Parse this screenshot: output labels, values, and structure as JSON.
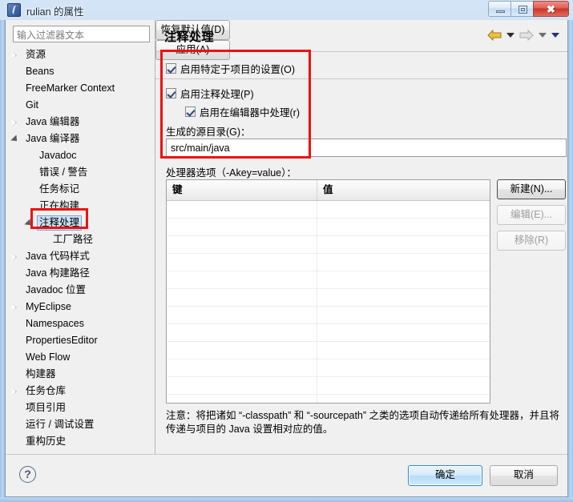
{
  "window": {
    "title": "rulian 的属性",
    "icon": "eclipse-icon",
    "buttons": {
      "minimize": "minimize-icon",
      "maximize": "maximize-icon",
      "close": "✖"
    }
  },
  "sidebar": {
    "filter": {
      "placeholder": "输入过滤器文本",
      "value": ""
    },
    "items": [
      {
        "label": "资源",
        "indent": 0,
        "state": "collapsed"
      },
      {
        "label": "Beans",
        "indent": 0,
        "state": "leaf"
      },
      {
        "label": "FreeMarker Context",
        "indent": 0,
        "state": "leaf"
      },
      {
        "label": "Git",
        "indent": 0,
        "state": "leaf"
      },
      {
        "label": "Java 编辑器",
        "indent": 0,
        "state": "collapsed"
      },
      {
        "label": "Java 编译器",
        "indent": 0,
        "state": "expanded"
      },
      {
        "label": "Javadoc",
        "indent": 1,
        "state": "leaf"
      },
      {
        "label": "错误 / 警告",
        "indent": 1,
        "state": "leaf"
      },
      {
        "label": "任务标记",
        "indent": 1,
        "state": "leaf"
      },
      {
        "label": "正在构建",
        "indent": 1,
        "state": "leaf"
      },
      {
        "label": "注释处理",
        "indent": 1,
        "state": "expanded",
        "selected": true
      },
      {
        "label": "工厂路径",
        "indent": 2,
        "state": "leaf"
      },
      {
        "label": "Java 代码样式",
        "indent": 0,
        "state": "collapsed"
      },
      {
        "label": "Java 构建路径",
        "indent": 0,
        "state": "leaf"
      },
      {
        "label": "Javadoc 位置",
        "indent": 0,
        "state": "leaf"
      },
      {
        "label": "MyEclipse",
        "indent": 0,
        "state": "collapsed"
      },
      {
        "label": "Namespaces",
        "indent": 0,
        "state": "leaf"
      },
      {
        "label": "PropertiesEditor",
        "indent": 0,
        "state": "leaf"
      },
      {
        "label": "Web Flow",
        "indent": 0,
        "state": "leaf"
      },
      {
        "label": "构建器",
        "indent": 0,
        "state": "leaf"
      },
      {
        "label": "任务仓库",
        "indent": 0,
        "state": "collapsed"
      },
      {
        "label": "项目引用",
        "indent": 0,
        "state": "leaf"
      },
      {
        "label": "运行 / 调试设置",
        "indent": 0,
        "state": "leaf"
      },
      {
        "label": "重构历史",
        "indent": 0,
        "state": "leaf"
      }
    ]
  },
  "page": {
    "title": "注释处理",
    "nav": {
      "back": "back-arrow-icon",
      "back_menu": "chevron-down-icon",
      "forward": "forward-arrow-icon",
      "forward_menu": "chevron-down-icon",
      "view_menu": "chevron-down-icon"
    },
    "checkboxes": [
      {
        "label": "启用特定于项目的设置(O)",
        "checked": true
      },
      {
        "label": "启用注释处理(P)",
        "checked": true
      },
      {
        "label": "启用在编辑器中处理(r)",
        "checked": true
      }
    ],
    "generated_dir": {
      "label": "生成的源目录(G)：",
      "value": "src/main/java"
    },
    "processor_options": {
      "label": "处理器选项（-Akey=value）：",
      "columns": [
        "键",
        "值"
      ],
      "rows": [],
      "empty_row_count": 12
    },
    "side_buttons": [
      {
        "label": "新建(N)...",
        "enabled": true
      },
      {
        "label": "编辑(E)...",
        "enabled": false
      },
      {
        "label": "移除(R)",
        "enabled": false
      }
    ],
    "note": "注意：将把诸如 “-classpath” 和 “-sourcepath” 之类的选项自动传递给所有处理器，并且将传递与项目的 Java 设置相对应的值。",
    "panel_buttons": [
      {
        "label": "恢复默认值(D)"
      },
      {
        "label": "应用(A)"
      }
    ]
  },
  "footer": {
    "help": "?",
    "ok": "确定",
    "cancel": "取消"
  },
  "annotations": {
    "highlight_color": "#ee1111",
    "boxes": [
      "tree-item-annotation-processing",
      "settings-group"
    ]
  }
}
